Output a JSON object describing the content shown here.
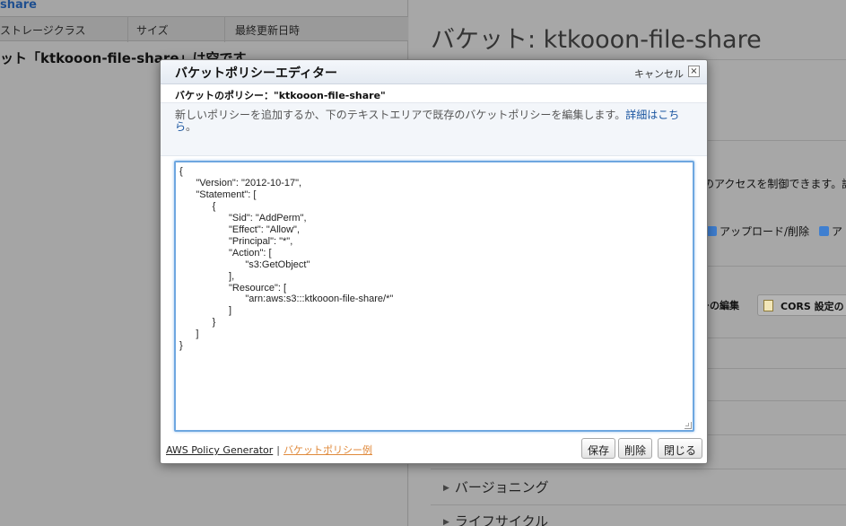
{
  "background": {
    "breadcrumb": "share",
    "columns": [
      "ストレージクラス",
      "サイズ",
      "最終更新日時"
    ],
    "empty_message": "ット「ktkooon-file-share」は空です",
    "bucket_title": "バケット: ktkooon-file-share",
    "access_text": "のアクセスを制御できます。詳",
    "perm_upload_delete": "アップロード/削除",
    "perm_next": "ア",
    "btn_edit_policy": "ーの編集",
    "btn_cors": "CORS 設定の",
    "sections": [
      "バージョニング",
      "ライフサイクル"
    ]
  },
  "modal": {
    "title": "バケットポリシーエディター",
    "cancel_label": "キャンセル",
    "close_icon": "×",
    "policy_label": "バケットのポリシー：\"ktkooon-file-share\"",
    "description": "新しいポリシーを追加するか、下のテキストエリアで既存のバケットポリシーを編集します。",
    "learn_more": "詳細はこちら",
    "description_end": "。",
    "policy_text": "{\n      \"Version\": \"2012-10-17\",\n      \"Statement\": [\n            {\n                  \"Sid\": \"AddPerm\",\n                  \"Effect\": \"Allow\",\n                  \"Principal\": \"*\",\n                  \"Action\": [\n                        \"s3:GetObject\"\n                  ],\n                  \"Resource\": [\n                        \"arn:aws:s3:::ktkooon-file-share/*\"\n                  ]\n            }\n      ]\n}",
    "link_generator": "AWS Policy Generator",
    "link_separator": "|",
    "link_examples": "バケットポリシー例",
    "btn_save": "保存",
    "btn_delete": "削除",
    "btn_close": "閉じる"
  }
}
